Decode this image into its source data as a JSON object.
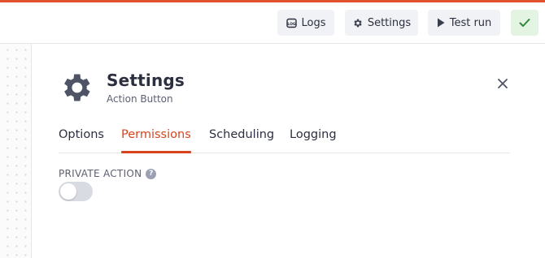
{
  "toolbar": {
    "logs_label": "Logs",
    "settings_label": "Settings",
    "test_run_label": "Test run",
    "accent_color": "#e0512c",
    "confirm_color": "#2f8a3a"
  },
  "panel": {
    "title": "Settings",
    "subtitle": "Action Button",
    "icon": "gear-icon",
    "close_icon": "close-icon"
  },
  "tabs": [
    {
      "label": "Options",
      "active": false
    },
    {
      "label": "Permissions",
      "active": true
    },
    {
      "label": "Scheduling",
      "active": false
    },
    {
      "label": "Logging",
      "active": false
    }
  ],
  "permissions": {
    "private_action_label": "PRIVATE ACTION",
    "help_icon": "?",
    "private_action_enabled": false
  }
}
